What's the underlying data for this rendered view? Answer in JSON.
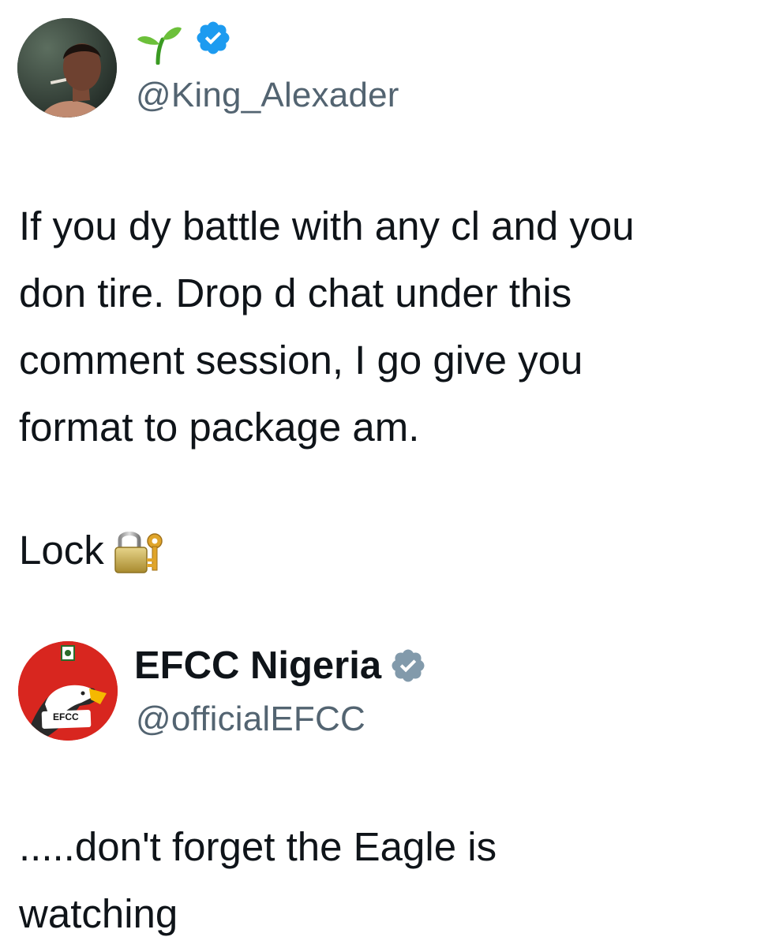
{
  "tweet_original": {
    "handle": "@King_Alexader",
    "name_icon": "seedling-icon",
    "verified_icon": "verified-badge-icon",
    "body_lines": [
      "If you dy battle with any cl and you",
      "don tire. Drop d chat under this",
      "comment session, I go give you",
      "format to package am."
    ],
    "lock_text": "Lock",
    "lock_icon": "lock-with-key-icon"
  },
  "tweet_reply": {
    "display_name": "EFCC Nigeria",
    "handle": "@officialEFCC",
    "avatar_label": "EFCC",
    "verified_icon": "verified-badge-icon",
    "body_lines": [
      ".....don't forget the Eagle is",
      "watching"
    ]
  },
  "colors": {
    "verified_blue": "#1d9bf0",
    "verified_gray": "#829aab",
    "handle_gray": "#536471",
    "efcc_red": "#d8261f"
  }
}
